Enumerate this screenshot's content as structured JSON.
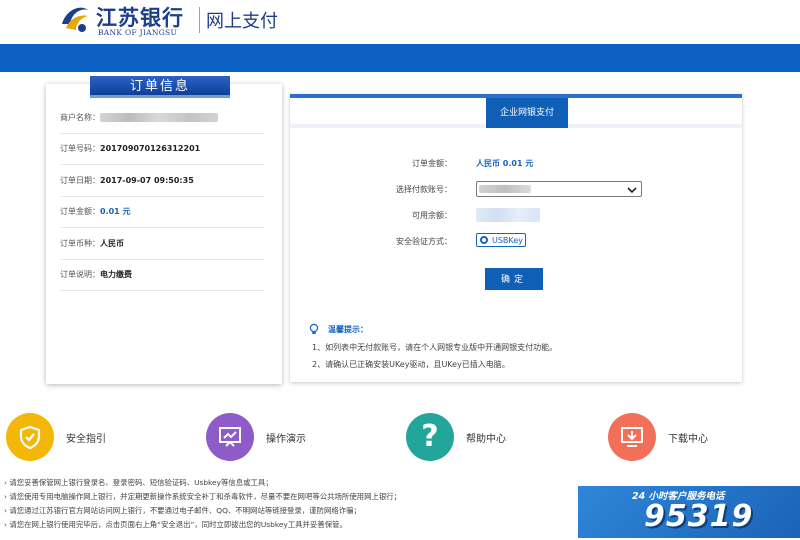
{
  "header": {
    "bank_name_cn": "江苏银行",
    "bank_name_en": "BANK OF JIANGSU",
    "subtitle": "网上支付"
  },
  "order": {
    "tab_title": "订单信息",
    "rows": [
      {
        "label": "商户名称：",
        "value": ""
      },
      {
        "label": "订单号码：",
        "value": "201709070126312201"
      },
      {
        "label": "订单日期：",
        "value": "2017-09-07 09:50:35"
      },
      {
        "label": "订单金额：",
        "value": "0.01 元"
      },
      {
        "label": "订单币种：",
        "value": "人民币"
      },
      {
        "label": "订单说明：",
        "value": "电力缴费"
      }
    ]
  },
  "payment": {
    "tab_title": "企业网银支付",
    "amount_label": "订单金额：",
    "amount_value": "人民币 0.01 元",
    "account_label": "选择付款账号：",
    "balance_label": "可用余额：",
    "security_label": "安全验证方式：",
    "security_option": "USBKey",
    "confirm_label": "确定",
    "tips_title": "温馨提示：",
    "tips": [
      "1、如列表中无付款账号，请在个人网银专业版中开通网银支付功能。",
      "2、请确认已正确安装UKey驱动，且UKey已插入电脑。"
    ]
  },
  "shortcuts": [
    {
      "label": "安全指引",
      "icon": "shield-icon",
      "color": "#f2b707"
    },
    {
      "label": "操作演示",
      "icon": "presentation-icon",
      "color": "#8f5bc8"
    },
    {
      "label": "帮助中心",
      "icon": "question-icon",
      "color": "#23a69a"
    },
    {
      "label": "下载中心",
      "icon": "download-icon",
      "color": "#f2705a"
    }
  ],
  "notices": [
    "请您妥善保管网上银行登录名、登录密码、短信验证码、Usbkey等信息或工具；",
    "请您使用专用电脑操作网上银行，并定期更新操作系统安全补丁和杀毒软件，尽量不要在网吧等公共场所使用网上银行；",
    "请您通过江苏银行官方网站访问网上银行，不要通过电子邮件、QQ、不明网站等链接登录，谨防网络诈骗；",
    "请您在网上银行使用完毕后，点击页面右上角“安全退出”，同时立即拔出您的Usbkey工具并妥善保管。"
  ],
  "hotline": {
    "title": "24 小时客户服务电话",
    "number": "95319"
  },
  "colors": {
    "brand_blue": "#0b62c4",
    "link_blue": "#1464c0"
  }
}
